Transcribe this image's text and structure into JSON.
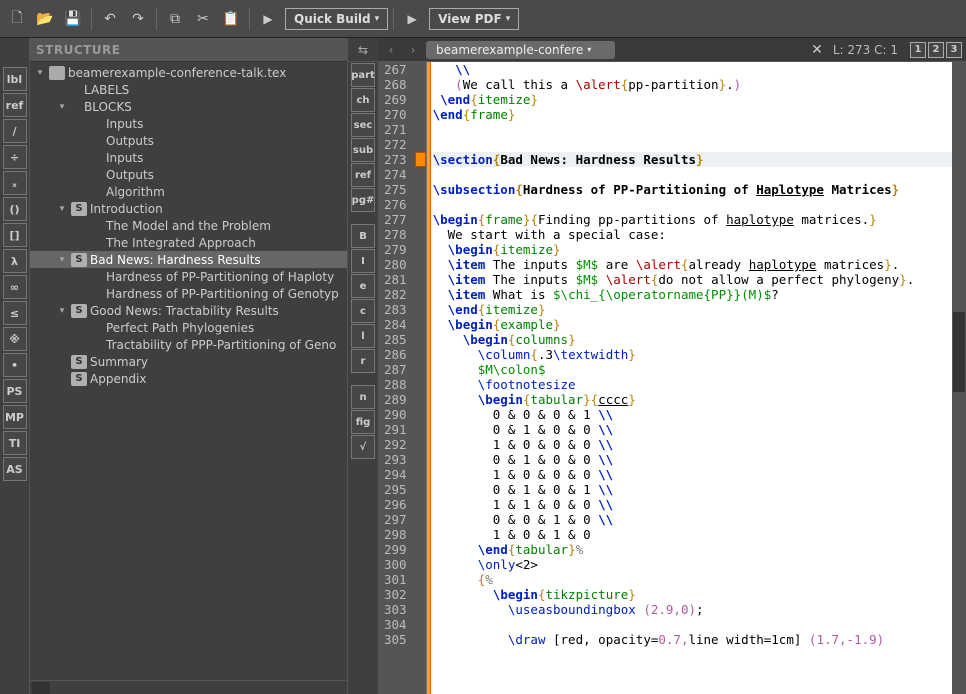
{
  "toolbar": {
    "quick_build_label": "Quick Build",
    "view_pdf_label": "View PDF"
  },
  "structure": {
    "header": "STRUCTURE",
    "tree": [
      {
        "depth": 0,
        "twisty": "▾",
        "icon": "file",
        "label": "beamerexample-conference-talk.tex"
      },
      {
        "depth": 1,
        "twisty": "",
        "icon": "",
        "label": "LABELS"
      },
      {
        "depth": 1,
        "twisty": "▾",
        "icon": "",
        "label": "BLOCKS"
      },
      {
        "depth": 2,
        "twisty": "",
        "icon": "",
        "label": "Inputs"
      },
      {
        "depth": 2,
        "twisty": "",
        "icon": "",
        "label": "Outputs"
      },
      {
        "depth": 2,
        "twisty": "",
        "icon": "",
        "label": "Inputs"
      },
      {
        "depth": 2,
        "twisty": "",
        "icon": "",
        "label": "Outputs"
      },
      {
        "depth": 2,
        "twisty": "",
        "icon": "",
        "label": "Algorithm"
      },
      {
        "depth": 1,
        "twisty": "▾",
        "icon": "s-badge",
        "label": "Introduction"
      },
      {
        "depth": 2,
        "twisty": "",
        "icon": "",
        "label": "The Model and the Problem"
      },
      {
        "depth": 2,
        "twisty": "",
        "icon": "",
        "label": "The Integrated Approach"
      },
      {
        "depth": 1,
        "twisty": "▾",
        "icon": "s-badge",
        "label": "Bad News: Hardness Results",
        "selected": true
      },
      {
        "depth": 2,
        "twisty": "",
        "icon": "",
        "label": "Hardness of PP-Partitioning of Haploty"
      },
      {
        "depth": 2,
        "twisty": "",
        "icon": "",
        "label": "Hardness of PP-Partitioning of Genotyp"
      },
      {
        "depth": 1,
        "twisty": "▾",
        "icon": "s-badge",
        "label": "Good News: Tractability Results"
      },
      {
        "depth": 2,
        "twisty": "",
        "icon": "",
        "label": "Perfect Path Phylogenies"
      },
      {
        "depth": 2,
        "twisty": "",
        "icon": "",
        "label": "Tractability of PPP-Partitioning of Geno"
      },
      {
        "depth": 1,
        "twisty": "",
        "icon": "s-badge",
        "label": "Summary"
      },
      {
        "depth": 1,
        "twisty": "",
        "icon": "s-badge",
        "label": "Appendix"
      }
    ]
  },
  "midbar_buttons": [
    "part",
    "ch",
    "sec",
    "sub",
    "ref",
    "pg#",
    "",
    "B",
    "I",
    "e",
    "c",
    "l",
    "r",
    "",
    "n",
    "fig",
    "√"
  ],
  "leftbar_buttons": [
    "lbl",
    "ref",
    "/",
    "÷",
    "ₓ",
    "()",
    "[]",
    "λ",
    "∞",
    "≤",
    "※",
    "•",
    "PS",
    "MP",
    "TI",
    "AS"
  ],
  "editor": {
    "tab_name": "beamerexample-confere",
    "position_label": "L: 273 C: 1",
    "markers": [
      "1",
      "2",
      "3"
    ],
    "first_line_no": 267,
    "highlight_line": 273,
    "flag_line": 273,
    "code_lines": [
      "   \\\\",
      "   (We call this a \\alert{pp-partition}.)",
      " \\end{itemize}",
      "\\end{frame}",
      "",
      "",
      "\\section{Bad News: Hardness Results}",
      "",
      "\\subsection{Hardness of PP-Partitioning of Haplotype Matrices}",
      "",
      "\\begin{frame}{Finding pp-partitions of haplotype matrices.}",
      "  We start with a special case:",
      "  \\begin{itemize}",
      "  \\item The inputs $M$ are \\alert{already haplotype matrices}.",
      "  \\item The inputs $M$ \\alert{do not allow a perfect phylogeny}.",
      "  \\item What is $\\chi_{\\operatorname{PP}}(M)$?",
      "  \\end{itemize}",
      "  \\begin{example}",
      "    \\begin{columns}",
      "      \\column{.3\\textwidth}",
      "      $M\\colon$",
      "      \\footnotesize",
      "      \\begin{tabular}{cccc}",
      "        0 & 0 & 0 & 1 \\\\",
      "        0 & 1 & 0 & 0 \\\\",
      "        1 & 0 & 0 & 0 \\\\",
      "        0 & 1 & 0 & 0 \\\\",
      "        1 & 0 & 0 & 0 \\\\",
      "        0 & 1 & 0 & 1 \\\\",
      "        1 & 1 & 0 & 0 \\\\",
      "        0 & 0 & 1 & 0 \\\\",
      "        1 & 0 & 1 & 0",
      "      \\end{tabular}%",
      "      \\only<2>",
      "      {%",
      "        \\begin{tikzpicture}",
      "          \\useasboundingbox (2.9,0);",
      "",
      "          \\draw [red, opacity=0.7,line width=1cm] (1.7,-1.9)"
    ]
  }
}
